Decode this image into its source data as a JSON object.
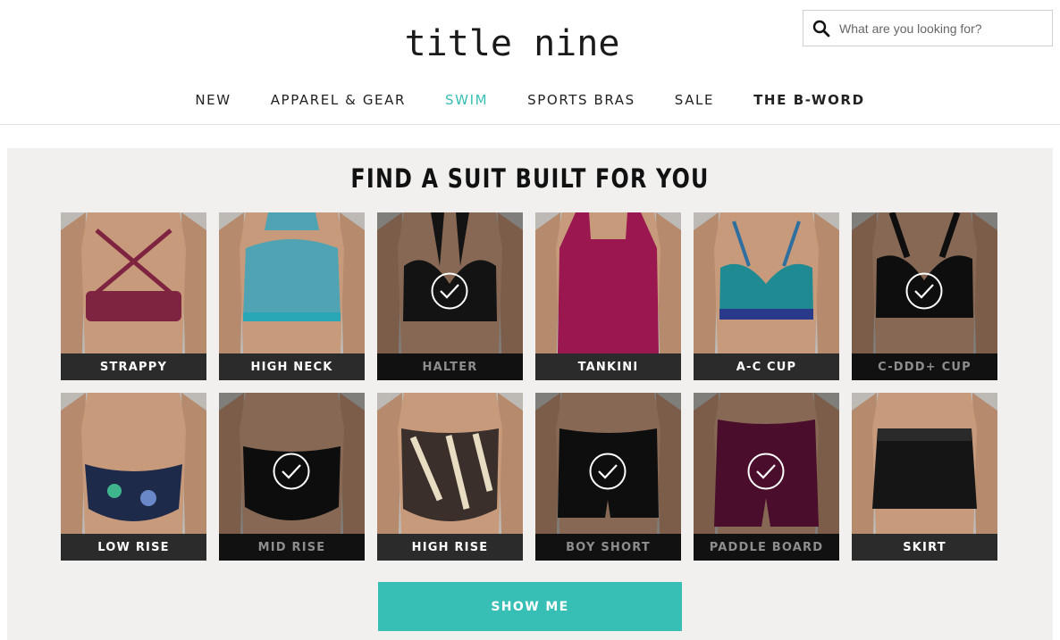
{
  "header": {
    "logo_text": "title nine",
    "search": {
      "placeholder": "What are you looking for?",
      "value": ""
    }
  },
  "nav": {
    "items": [
      {
        "label": "NEW"
      },
      {
        "label": "APPAREL & GEAR"
      },
      {
        "label": "SWIM",
        "active": true
      },
      {
        "label": "SPORTS BRAS"
      },
      {
        "label": "SALE"
      },
      {
        "label": "THE B-WORD",
        "bold": true
      }
    ]
  },
  "finder": {
    "title": "FIND A SUIT BUILT FOR YOU",
    "tops": [
      {
        "label": "STRAPPY",
        "selected": false,
        "garment": "strappy",
        "color": "#7e2340"
      },
      {
        "label": "HIGH NECK",
        "selected": false,
        "garment": "highneck",
        "color": "#4fa3b3"
      },
      {
        "label": "HALTER",
        "selected": true,
        "garment": "halter",
        "color": "#1c1c1c"
      },
      {
        "label": "TANKINI",
        "selected": false,
        "garment": "tankini",
        "color": "#9b1750"
      },
      {
        "label": "A-C CUP",
        "selected": false,
        "garment": "accup",
        "color": "#1f8a92"
      },
      {
        "label": "C-DDD+ CUP",
        "selected": true,
        "garment": "cddd",
        "color": "#151515"
      }
    ],
    "bottoms": [
      {
        "label": "LOW RISE",
        "selected": false,
        "garment": "lowrise",
        "color": "#1e2a4a"
      },
      {
        "label": "MID RISE",
        "selected": true,
        "garment": "midrise",
        "color": "#141414"
      },
      {
        "label": "HIGH RISE",
        "selected": false,
        "garment": "highrise",
        "color": "#3a2f2a"
      },
      {
        "label": "BOY SHORT",
        "selected": true,
        "garment": "boyshort",
        "color": "#161616"
      },
      {
        "label": "PADDLE BOARD",
        "selected": true,
        "garment": "paddle",
        "color": "#6d1440"
      },
      {
        "label": "SKIRT",
        "selected": false,
        "garment": "skirt",
        "color": "#151515"
      }
    ],
    "cta_label": "SHOW ME"
  },
  "colors": {
    "accent": "#37bfb6",
    "panel_bg": "#f1f0ee",
    "label_bg": "#2b2b2b",
    "skin": "#c79a7c"
  }
}
